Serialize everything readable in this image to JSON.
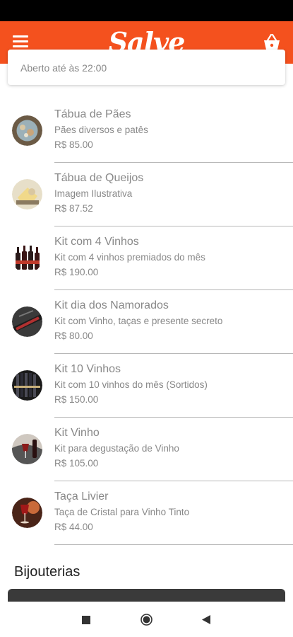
{
  "app": {
    "title": "Salve"
  },
  "store": {
    "hours_text": "Aberto até às 22:00"
  },
  "products": [
    {
      "name": "Tábua de Pães",
      "description": "Pães diversos e patês",
      "price": "R$ 85.00"
    },
    {
      "name": "Tábua de Queijos",
      "description": "Imagem Ilustrativa",
      "price": "R$ 87.52"
    },
    {
      "name": "Kit com 4 Vinhos",
      "description": "Kit com 4 vinhos premiados do mês",
      "price": "R$ 190.00"
    },
    {
      "name": "Kit dia dos Namorados",
      "description": "Kit com Vinho, taças e presente secreto",
      "price": "R$ 80.00"
    },
    {
      "name": "Kit 10 Vinhos",
      "description": "Kit com 10 vinhos do mês (Sortidos)",
      "price": "R$ 150.00"
    },
    {
      "name": "Kit Vinho",
      "description": "Kit para degustação de Vinho",
      "price": "R$ 105.00"
    },
    {
      "name": "Taça Livier",
      "description": "Taça de Cristal para Vinho Tinto",
      "price": "R$ 44.00"
    }
  ],
  "sections": {
    "next_title": "Bijouterias"
  },
  "colors": {
    "app_bar": "#f4511e"
  },
  "icons": {
    "menu": "hamburger-menu-icon",
    "cart": "shopping-basket-icon",
    "nav_recents": "square-icon",
    "nav_home": "circle-icon",
    "nav_back": "triangle-back-icon"
  }
}
